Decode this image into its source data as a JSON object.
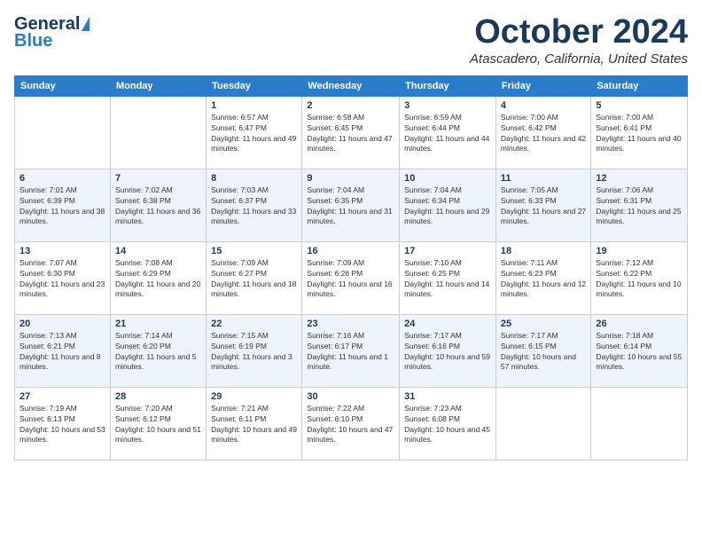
{
  "header": {
    "logo_line1": "General",
    "logo_line2": "Blue",
    "month": "October 2024",
    "location": "Atascadero, California, United States"
  },
  "days_of_week": [
    "Sunday",
    "Monday",
    "Tuesday",
    "Wednesday",
    "Thursday",
    "Friday",
    "Saturday"
  ],
  "weeks": [
    [
      {
        "day": "",
        "info": ""
      },
      {
        "day": "",
        "info": ""
      },
      {
        "day": "1",
        "info": "Sunrise: 6:57 AM\nSunset: 6:47 PM\nDaylight: 11 hours and 49 minutes."
      },
      {
        "day": "2",
        "info": "Sunrise: 6:58 AM\nSunset: 6:45 PM\nDaylight: 11 hours and 47 minutes."
      },
      {
        "day": "3",
        "info": "Sunrise: 6:59 AM\nSunset: 6:44 PM\nDaylight: 11 hours and 44 minutes."
      },
      {
        "day": "4",
        "info": "Sunrise: 7:00 AM\nSunset: 6:42 PM\nDaylight: 11 hours and 42 minutes."
      },
      {
        "day": "5",
        "info": "Sunrise: 7:00 AM\nSunset: 6:41 PM\nDaylight: 11 hours and 40 minutes."
      }
    ],
    [
      {
        "day": "6",
        "info": "Sunrise: 7:01 AM\nSunset: 6:39 PM\nDaylight: 11 hours and 38 minutes."
      },
      {
        "day": "7",
        "info": "Sunrise: 7:02 AM\nSunset: 6:38 PM\nDaylight: 11 hours and 36 minutes."
      },
      {
        "day": "8",
        "info": "Sunrise: 7:03 AM\nSunset: 6:37 PM\nDaylight: 11 hours and 33 minutes."
      },
      {
        "day": "9",
        "info": "Sunrise: 7:04 AM\nSunset: 6:35 PM\nDaylight: 11 hours and 31 minutes."
      },
      {
        "day": "10",
        "info": "Sunrise: 7:04 AM\nSunset: 6:34 PM\nDaylight: 11 hours and 29 minutes."
      },
      {
        "day": "11",
        "info": "Sunrise: 7:05 AM\nSunset: 6:33 PM\nDaylight: 11 hours and 27 minutes."
      },
      {
        "day": "12",
        "info": "Sunrise: 7:06 AM\nSunset: 6:31 PM\nDaylight: 11 hours and 25 minutes."
      }
    ],
    [
      {
        "day": "13",
        "info": "Sunrise: 7:07 AM\nSunset: 6:30 PM\nDaylight: 11 hours and 23 minutes."
      },
      {
        "day": "14",
        "info": "Sunrise: 7:08 AM\nSunset: 6:29 PM\nDaylight: 11 hours and 20 minutes."
      },
      {
        "day": "15",
        "info": "Sunrise: 7:09 AM\nSunset: 6:27 PM\nDaylight: 11 hours and 18 minutes."
      },
      {
        "day": "16",
        "info": "Sunrise: 7:09 AM\nSunset: 6:26 PM\nDaylight: 11 hours and 16 minutes."
      },
      {
        "day": "17",
        "info": "Sunrise: 7:10 AM\nSunset: 6:25 PM\nDaylight: 11 hours and 14 minutes."
      },
      {
        "day": "18",
        "info": "Sunrise: 7:11 AM\nSunset: 6:23 PM\nDaylight: 11 hours and 12 minutes."
      },
      {
        "day": "19",
        "info": "Sunrise: 7:12 AM\nSunset: 6:22 PM\nDaylight: 11 hours and 10 minutes."
      }
    ],
    [
      {
        "day": "20",
        "info": "Sunrise: 7:13 AM\nSunset: 6:21 PM\nDaylight: 11 hours and 8 minutes."
      },
      {
        "day": "21",
        "info": "Sunrise: 7:14 AM\nSunset: 6:20 PM\nDaylight: 11 hours and 5 minutes."
      },
      {
        "day": "22",
        "info": "Sunrise: 7:15 AM\nSunset: 6:19 PM\nDaylight: 11 hours and 3 minutes."
      },
      {
        "day": "23",
        "info": "Sunrise: 7:16 AM\nSunset: 6:17 PM\nDaylight: 11 hours and 1 minute."
      },
      {
        "day": "24",
        "info": "Sunrise: 7:17 AM\nSunset: 6:16 PM\nDaylight: 10 hours and 59 minutes."
      },
      {
        "day": "25",
        "info": "Sunrise: 7:17 AM\nSunset: 6:15 PM\nDaylight: 10 hours and 57 minutes."
      },
      {
        "day": "26",
        "info": "Sunrise: 7:18 AM\nSunset: 6:14 PM\nDaylight: 10 hours and 55 minutes."
      }
    ],
    [
      {
        "day": "27",
        "info": "Sunrise: 7:19 AM\nSunset: 6:13 PM\nDaylight: 10 hours and 53 minutes."
      },
      {
        "day": "28",
        "info": "Sunrise: 7:20 AM\nSunset: 6:12 PM\nDaylight: 10 hours and 51 minutes."
      },
      {
        "day": "29",
        "info": "Sunrise: 7:21 AM\nSunset: 6:11 PM\nDaylight: 10 hours and 49 minutes."
      },
      {
        "day": "30",
        "info": "Sunrise: 7:22 AM\nSunset: 6:10 PM\nDaylight: 10 hours and 47 minutes."
      },
      {
        "day": "31",
        "info": "Sunrise: 7:23 AM\nSunset: 6:08 PM\nDaylight: 10 hours and 45 minutes."
      },
      {
        "day": "",
        "info": ""
      },
      {
        "day": "",
        "info": ""
      }
    ]
  ]
}
